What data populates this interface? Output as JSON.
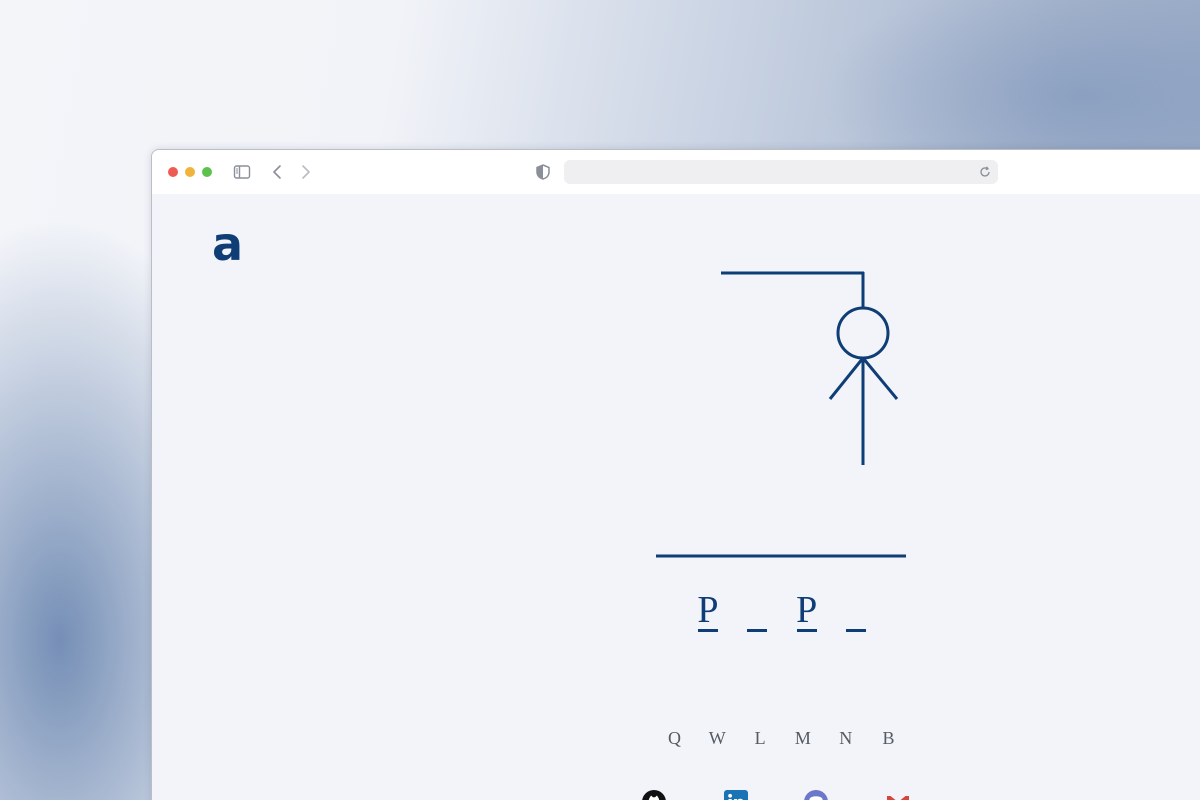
{
  "colors": {
    "accent": "#0f3d75",
    "guessed_text": "#555a63",
    "traffic_red": "#ee5b54",
    "traffic_yellow": "#f1b33b",
    "traffic_green": "#5cc24d",
    "chrome_icon": "#8a8f98",
    "github": "#111111",
    "linkedin": "#1a73b5",
    "discord": "#6b78c9",
    "gmail": "#d4463b"
  },
  "browser": {
    "toolbar_icons": [
      "sidebar-toggle-icon",
      "back-arrow-icon",
      "forward-arrow-icon",
      "shield-icon",
      "reload-icon"
    ],
    "address": ""
  },
  "site": {
    "logo_letter": "a"
  },
  "hangman": {
    "figure_parts": [
      "head",
      "body",
      "left-arm",
      "right-arm"
    ],
    "word_slots": [
      {
        "letter": "P"
      },
      {
        "letter": ""
      },
      {
        "letter": "P"
      },
      {
        "letter": ""
      }
    ],
    "guessed_letters": [
      "Q",
      "W",
      "L",
      "M",
      "N",
      "B"
    ]
  },
  "footer": {
    "social_icons": [
      "github-icon",
      "linkedin-icon",
      "discord-icon",
      "gmail-icon"
    ]
  }
}
